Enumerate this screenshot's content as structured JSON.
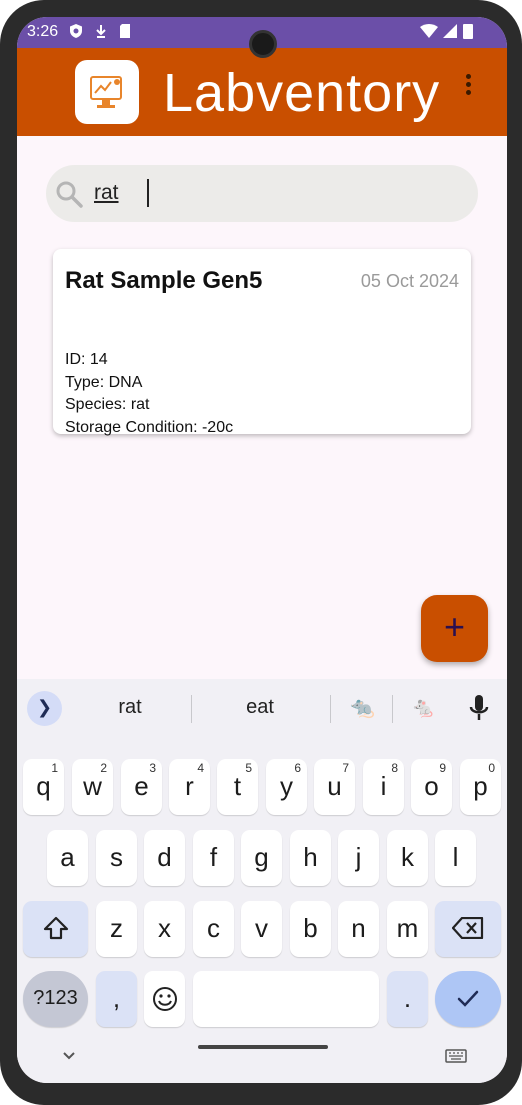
{
  "status_bar": {
    "time": "3:26"
  },
  "app_bar": {
    "title": "Labventory"
  },
  "search": {
    "value": "rat"
  },
  "results": [
    {
      "title": "Rat Sample Gen5",
      "date": "05 Oct 2024",
      "id": "ID: 14",
      "type": "Type: DNA",
      "species": "Species: rat",
      "storage": "Storage Condition: -20c"
    }
  ],
  "fab": {
    "label": "+"
  },
  "keyboard": {
    "suggestions": [
      "rat",
      "eat"
    ],
    "row1": [
      "q",
      "w",
      "e",
      "r",
      "t",
      "y",
      "u",
      "i",
      "o",
      "p"
    ],
    "row1_numbers": [
      "1",
      "2",
      "3",
      "4",
      "5",
      "6",
      "7",
      "8",
      "9",
      "0"
    ],
    "row2": [
      "a",
      "s",
      "d",
      "f",
      "g",
      "h",
      "j",
      "k",
      "l"
    ],
    "row3": [
      "z",
      "x",
      "c",
      "v",
      "b",
      "n",
      "m"
    ],
    "symbols_key": "?123",
    "comma_key": ",",
    "period_key": "."
  }
}
